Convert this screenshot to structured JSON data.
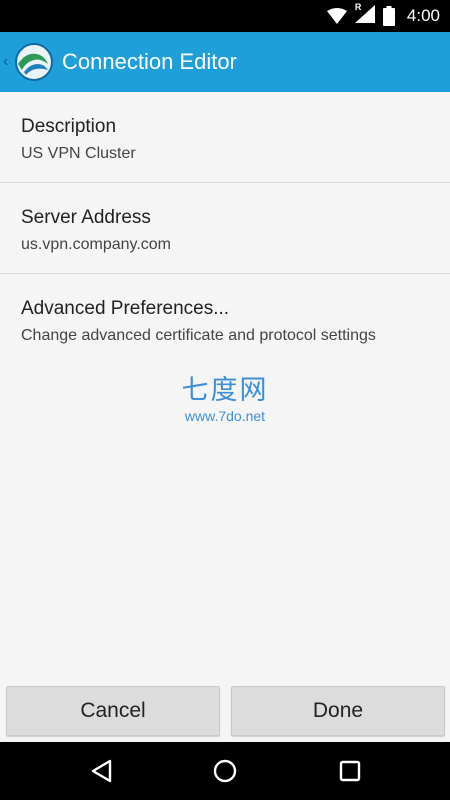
{
  "status_bar": {
    "time": "4:00",
    "roaming_mark": "R",
    "icons": [
      "wifi-icon",
      "signal-icon",
      "battery-icon"
    ]
  },
  "app_bar": {
    "title": "Connection Editor",
    "background": "#1f9fd9",
    "icons": [
      "back-chevron-icon",
      "app-logo-icon"
    ]
  },
  "list": {
    "items": [
      {
        "title": "Description",
        "subtitle": "US VPN Cluster"
      },
      {
        "title": "Server Address",
        "subtitle": "us.vpn.company.com"
      },
      {
        "title": "Advanced Preferences...",
        "subtitle": "Change advanced certificate and protocol settings"
      }
    ]
  },
  "watermark": {
    "text": "七度网",
    "url": "www.7do.net",
    "color": "#3f8fd8"
  },
  "buttons": {
    "cancel": "Cancel",
    "done": "Done"
  },
  "nav_bar": {
    "icons": [
      "back-triangle-icon",
      "home-circle-icon",
      "recents-square-icon"
    ]
  }
}
